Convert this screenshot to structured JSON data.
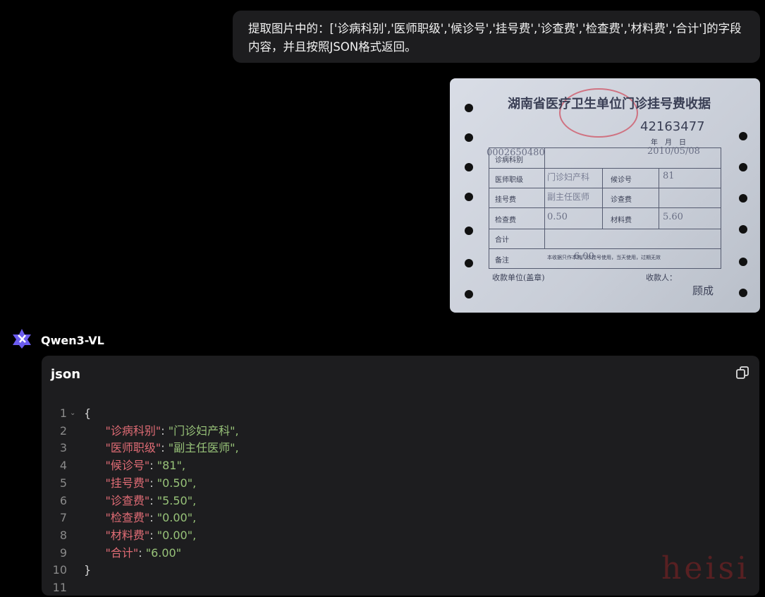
{
  "user_message": "提取图片中的：['诊病科别','医师职级','候诊号','挂号费','诊查费','检查费','材料费','合计']的字段内容，并且按照JSON格式返回。",
  "receipt_image": {
    "title": "湖南省医疗卫生单位门诊挂号费收据",
    "number": "42163477",
    "date_label": "年　月　日",
    "date": "2010/05/08",
    "serial": "0002650480",
    "rows": [
      "诊病科别",
      "医师职级",
      "挂号费",
      "检查费",
      "合计",
      "备注"
    ],
    "right_labels": [
      "候诊号",
      "诊查费",
      "材料费"
    ],
    "values": {
      "dept": "门诊妇产科",
      "level": "副主任医师",
      "fee1": "0.50",
      "fee2": "5.60",
      "queue": "81",
      "total": "6.00"
    },
    "note": "本收据只作本院门诊挂号使用，当天使用，过期无效",
    "footer_left": "收款单位(盖章)",
    "footer_right": "收款人：",
    "signature": "顾成"
  },
  "agent": {
    "name": "Qwen3-VL",
    "icon": "qwen-logo-icon"
  },
  "code_block": {
    "lang": "json",
    "copy_icon": "copy-icon",
    "lines": [
      {
        "n": "1",
        "text": "{"
      },
      {
        "n": "2",
        "k": "\"诊病科别\"",
        "v": "\"门诊妇产科\","
      },
      {
        "n": "3",
        "k": "\"医师职级\"",
        "v": "\"副主任医师\","
      },
      {
        "n": "4",
        "k": "\"候诊号\"",
        "v": "\"81\","
      },
      {
        "n": "5",
        "k": "\"挂号费\"",
        "v": "\"0.50\","
      },
      {
        "n": "6",
        "k": "\"诊查费\"",
        "v": "\"5.50\","
      },
      {
        "n": "7",
        "k": "\"检查费\"",
        "v": "\"0.00\","
      },
      {
        "n": "8",
        "k": "\"材料费\"",
        "v": "\"0.00\","
      },
      {
        "n": "9",
        "k": "\"合计\"",
        "v": "\"6.00\""
      },
      {
        "n": "10",
        "text": "}"
      },
      {
        "n": "11",
        "text": ""
      }
    ]
  },
  "watermark": "heisi"
}
